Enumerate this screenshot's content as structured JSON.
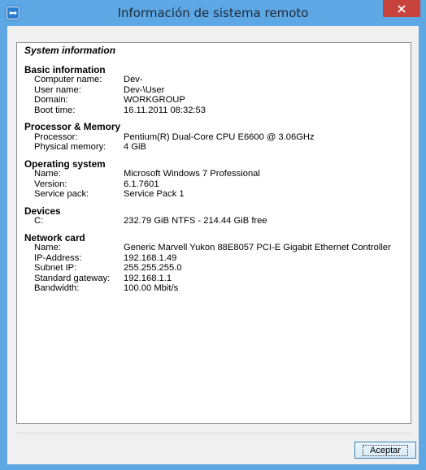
{
  "window": {
    "title": "Información de sistema remoto"
  },
  "panel": {
    "heading": "System information",
    "sections": [
      {
        "title": "Basic information",
        "rows": [
          {
            "label": "Computer name:",
            "value": "Dev-"
          },
          {
            "label": "User name:",
            "value": "Dev-\\User"
          },
          {
            "label": "Domain:",
            "value": "WORKGROUP"
          },
          {
            "label": "Boot time:",
            "value": "16.11.2011 08:32:53"
          }
        ]
      },
      {
        "title": "Processor & Memory",
        "rows": [
          {
            "label": "Processor:",
            "value": "Pentium(R) Dual-Core  CPU     E6600  @ 3.06GHz"
          },
          {
            "label": "Physical memory:",
            "value": "4 GiB"
          }
        ]
      },
      {
        "title": "Operating system",
        "rows": [
          {
            "label": "Name:",
            "value": "Microsoft Windows 7 Professional"
          },
          {
            "label": "Version:",
            "value": "6.1.7601"
          },
          {
            "label": "Service pack:",
            "value": "Service Pack 1"
          }
        ]
      },
      {
        "title": "Devices",
        "rows": [
          {
            "label": "C:",
            "value": "232.79 GiB NTFS - 214.44 GiB free"
          }
        ]
      },
      {
        "title": "Network card",
        "rows": [
          {
            "label": "Name:",
            "value": "Generic Marvell Yukon 88E8057 PCI-E Gigabit Ethernet Controller"
          },
          {
            "label": "IP-Address:",
            "value": "192.168.1.49"
          },
          {
            "label": "Subnet IP:",
            "value": "255.255.255.0"
          },
          {
            "label": "Standard gateway:",
            "value": "192.168.1.1"
          },
          {
            "label": "Bandwidth:",
            "value": "100.00 Mbit/s"
          }
        ]
      }
    ]
  },
  "buttons": {
    "accept_label": "Aceptar"
  }
}
